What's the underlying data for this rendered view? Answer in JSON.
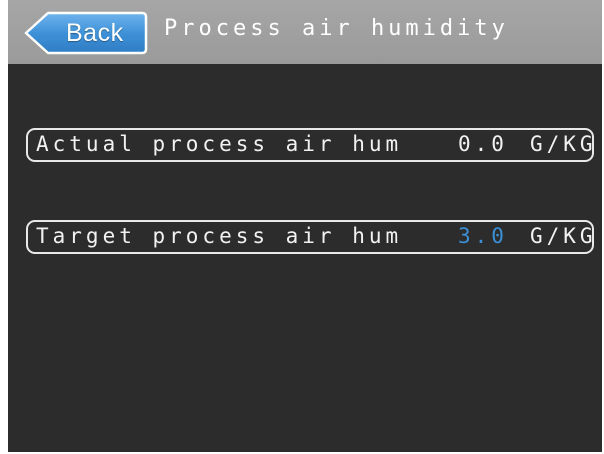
{
  "header": {
    "back_label": "Back",
    "title": "Process air humidity"
  },
  "rows": [
    {
      "label": "Actual process air hum",
      "value": "0.0",
      "unit": "G/KG"
    },
    {
      "label": "Target process air hum",
      "value": "3.0",
      "unit": "G/KG"
    }
  ],
  "colors": {
    "background": "#2c2c2c",
    "header": "#a6a6a6",
    "back_button": "#3f92d8",
    "target_value": "#3b8fd6",
    "text": "#f2f2f2"
  }
}
